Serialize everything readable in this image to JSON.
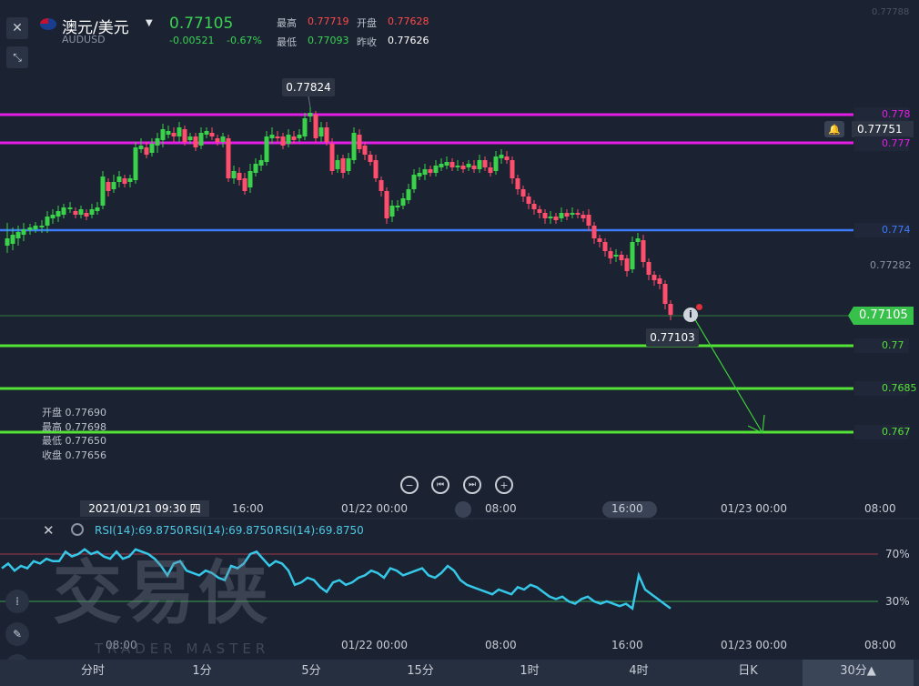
{
  "symbol": {
    "name": "澳元/美元",
    "code": "AUDUSD",
    "price": "0.77105",
    "change": "-0.00521",
    "change_pct": "-0.67%",
    "high_label": "最高",
    "high": "0.77719",
    "open_label": "开盘",
    "open": "0.77628",
    "low_label": "最低",
    "low": "0.77093",
    "prev_label": "昨收",
    "prev": "0.77626"
  },
  "top_right_hint": "0.77788",
  "price_levels": {
    "l778": "0.778",
    "l777": "0.777",
    "l774": "0.774",
    "l77282": "0.77282",
    "current": "0.77105",
    "l77": "0.77",
    "l7685": "0.7685",
    "l767": "0.767",
    "l77751": "0.77751"
  },
  "annotations": {
    "peak": "0.77824",
    "last_low": "0.77103"
  },
  "ohlc": {
    "open": "开盘 0.77690",
    "high": "最高 0.77698",
    "low": "最低 0.77650",
    "close": "收盘 0.77656"
  },
  "time_axis": {
    "cursor": "2021/01/21  09:30 四",
    "t1": "16:00",
    "t2": "01/22 00:00",
    "t3": "08:00",
    "t4": "16:00",
    "t5": "01/23 00:00",
    "t6": "08:00"
  },
  "rsi": {
    "labels": [
      "RSI(14):69.8750",
      "RSI(14):69.8750",
      "RSI(14):69.8750"
    ],
    "level70": "70%",
    "level30": "30%"
  },
  "watermark": {
    "main": "交易侠",
    "sub": "TRADER MASTER"
  },
  "tabs": [
    "分时",
    "1分",
    "5分",
    "15分",
    "1时",
    "4时",
    "日K",
    "30分▲"
  ],
  "colors": {
    "up": "#ff4d6d",
    "down": "#3ad24a",
    "magenta": "#e51ee6",
    "blue": "#3d7bff",
    "green_line": "#55e236",
    "rsi": "#35c8e8"
  }
}
